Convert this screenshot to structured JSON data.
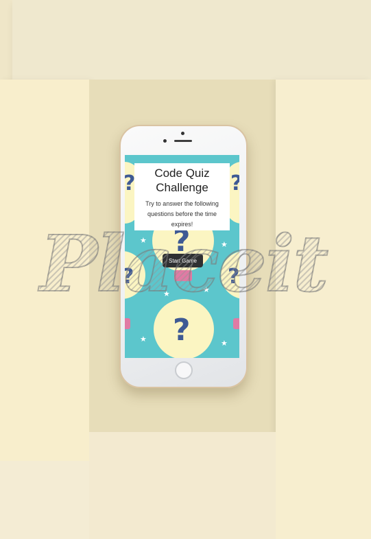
{
  "screen": {
    "title": "Code Quiz Challenge",
    "description": "Try to answer the following questions before the time expires!",
    "start_button_label": "Start Game"
  },
  "watermark": {
    "text": "Placeit"
  },
  "colors": {
    "screen_background": "#5cc6cc",
    "bulb": "#fbf5c2",
    "question_mark": "#3e5a94",
    "button": "#2f3032"
  }
}
